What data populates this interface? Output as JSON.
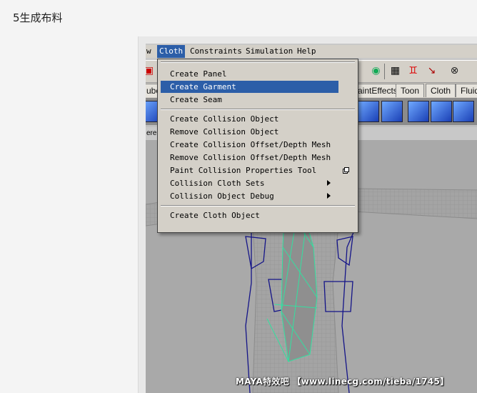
{
  "page": {
    "step_heading": "5生成布料"
  },
  "menubar": {
    "items": [
      {
        "label": "w"
      },
      {
        "label": "Cloth"
      },
      {
        "label": "Constraints"
      },
      {
        "label": "Simulation"
      },
      {
        "label": "Help"
      }
    ],
    "active_item": "Cloth"
  },
  "toolbar": {
    "icons": [
      "selection-mask-icon",
      "sphere-icon",
      "grid-snap-icon",
      "curve-snap-icon",
      "point-snap-icon",
      "plane-snap-icon"
    ]
  },
  "shelf_tabs": {
    "items": [
      {
        "label": "ubc"
      },
      {
        "label": "aintEffects"
      },
      {
        "label": "Toon"
      },
      {
        "label": "Cloth"
      },
      {
        "label": "Fluids"
      }
    ]
  },
  "panel_bar": {
    "label": "ere"
  },
  "cloth_menu": {
    "groups": [
      [
        {
          "label": "Create Panel"
        },
        {
          "label": "Create Garment",
          "highlighted": true
        },
        {
          "label": "Create Seam"
        }
      ],
      [
        {
          "label": "Create Collision Object"
        },
        {
          "label": "Remove Collision Object"
        },
        {
          "label": "Create Collision Offset/Depth Mesh"
        },
        {
          "label": "Remove Collision Offset/Depth Mesh"
        },
        {
          "label": "Paint Collision Properties Tool",
          "option_box": true
        },
        {
          "label": "Collision Cloth Sets",
          "submenu": true
        },
        {
          "label": "Collision Object Debug",
          "submenu": true
        }
      ],
      [
        {
          "label": "Create Cloth Object"
        }
      ]
    ]
  },
  "watermark": {
    "text": "MAYA特效吧 【www.linecg.com/tieba/1745】"
  },
  "colors": {
    "highlight": "#2c5ea8",
    "menu_bg": "#d4d0c8",
    "wireframe": "#1a1a8c",
    "garment": "#33e0a0"
  }
}
